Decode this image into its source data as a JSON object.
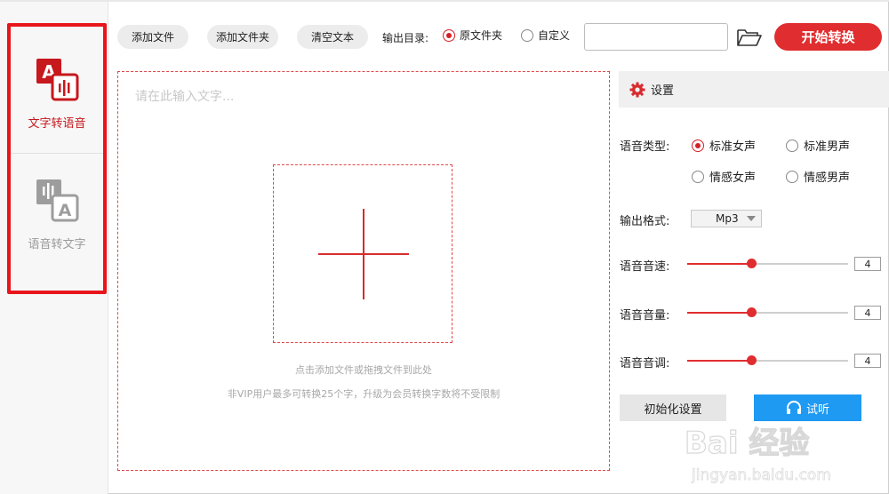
{
  "sidebar": {
    "items": [
      {
        "label": "文字转语音",
        "active": true,
        "icon": "text-to-speech-icon"
      },
      {
        "label": "语音转文字",
        "active": false,
        "icon": "speech-to-text-icon"
      }
    ]
  },
  "toolbar": {
    "add_file": "添加文件",
    "add_folder": "添加文件夹",
    "clear_text": "清空文本",
    "output_dir_label": "输出目录:",
    "option_original": "原文件夹",
    "option_custom": "自定义",
    "output_path_value": "",
    "start": "开始转换"
  },
  "editor": {
    "placeholder": "请在此输入文字...",
    "hint_line1": "点击添加文件或拖拽文件到此处",
    "hint_line2": "非VIP用户最多可转换25个字，升级为会员转换字数将不受限制"
  },
  "settings": {
    "title": "设置",
    "voice_type_label": "语音类型:",
    "voices": [
      "标准女声",
      "标准男声",
      "情感女声",
      "情感男声"
    ],
    "selected_voice": "标准女声",
    "format_label": "输出格式:",
    "format_value": "Mp3",
    "speed_label": "语音音速:",
    "speed_value": "4",
    "volume_label": "语音音量:",
    "volume_value": "4",
    "pitch_label": "语音音调:",
    "pitch_value": "4",
    "slider_max": 10,
    "reset": "初始化设置",
    "listen": "试听"
  },
  "watermark": {
    "text": "Bai 经验",
    "subtext": "jingyan.baidu.com"
  },
  "colors": {
    "accent": "#e02d2f",
    "highlight": "#e8161c",
    "listen": "#1e9af3"
  }
}
